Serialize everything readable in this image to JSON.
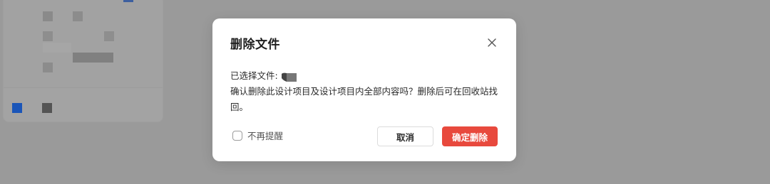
{
  "dialog": {
    "title": "删除文件",
    "selected_label": "已选择文件:",
    "message": "确认删除此设计项目及设计项目内全部内容吗？删除后可在回收站找回。",
    "dont_remind_label": "不再提醒",
    "dont_remind_checked": false,
    "cancel_label": "取消",
    "confirm_label": "确定删除"
  },
  "colors": {
    "overlay": "#9a9a9a",
    "confirm_button": "#e8493d",
    "accent_blue": "#1a55b8"
  },
  "icons": {
    "close": "close-icon",
    "file_thumbnail": "file-thumbnail-icon"
  }
}
